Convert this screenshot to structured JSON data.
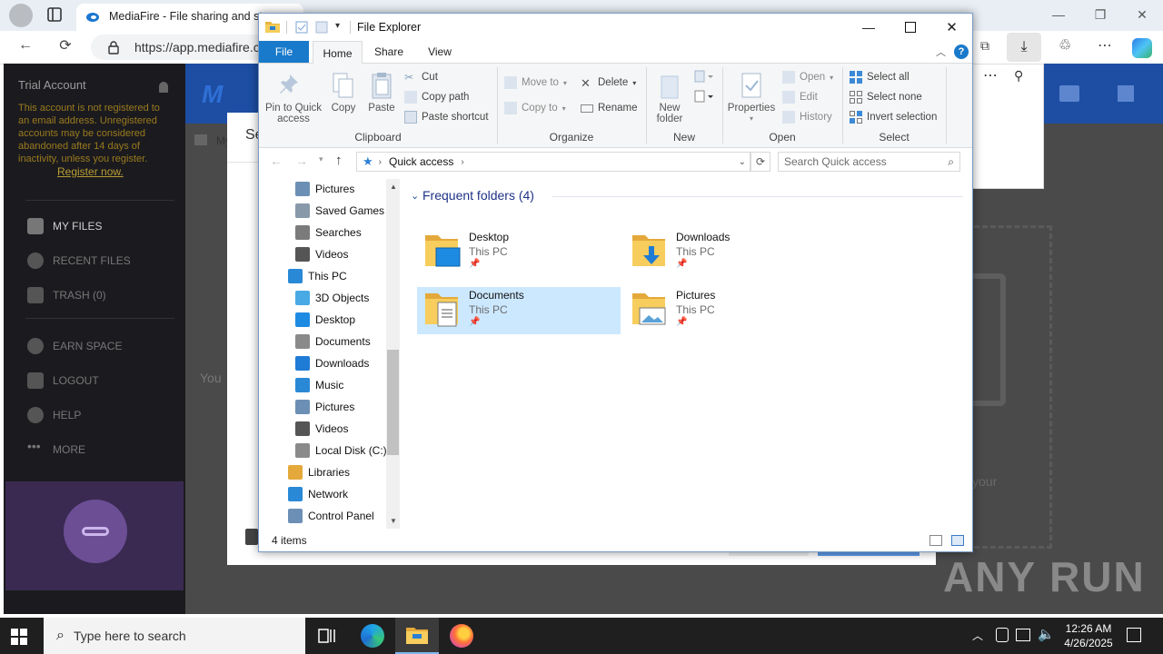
{
  "browser": {
    "tab_title": "MediaFire - File sharing and sto",
    "url": "https://app.mediafire.c"
  },
  "mediafire": {
    "sidebar": {
      "account_title": "Trial Account",
      "account_notice": "This account is not registered to an email address. Unregistered accounts may be considered abandoned after 14 days of inactivity, unless you register.",
      "register_link": "Register now.",
      "nav": [
        {
          "label": "MY FILES"
        },
        {
          "label": "RECENT FILES"
        },
        {
          "label": "TRASH (0)"
        },
        {
          "label": "EARN SPACE"
        },
        {
          "label": "LOGOUT"
        },
        {
          "label": "HELP"
        },
        {
          "label": "MORE"
        }
      ]
    },
    "header_logo": "M",
    "breadcrumb_fragment": "My",
    "modal_heading_fragment": "Se",
    "modal_body_fragment": "You",
    "background_text_fragment": "your"
  },
  "explorer": {
    "title": "File Explorer",
    "tabs": [
      "File",
      "Home",
      "Share",
      "View"
    ],
    "ribbon": {
      "clipboard": {
        "label": "Clipboard",
        "pin": "Pin to Quick access",
        "copy": "Copy",
        "paste": "Paste",
        "cut": "Cut",
        "copy_path": "Copy path",
        "paste_shortcut": "Paste shortcut"
      },
      "organize": {
        "label": "Organize",
        "move_to": "Move to",
        "copy_to": "Copy to",
        "delete": "Delete",
        "rename": "Rename"
      },
      "new": {
        "label": "New",
        "new_folder": "New folder"
      },
      "open": {
        "label": "Open",
        "properties": "Properties",
        "open": "Open",
        "edit": "Edit",
        "history": "History"
      },
      "select": {
        "label": "Select",
        "select_all": "Select all",
        "select_none": "Select none",
        "invert": "Invert selection"
      }
    },
    "address": "Quick access",
    "search_placeholder": "Search Quick access",
    "nav_pane": [
      {
        "label": "Pictures"
      },
      {
        "label": "Saved Games"
      },
      {
        "label": "Searches"
      },
      {
        "label": "Videos"
      },
      {
        "label": "This PC"
      },
      {
        "label": "3D Objects"
      },
      {
        "label": "Desktop"
      },
      {
        "label": "Documents"
      },
      {
        "label": "Downloads"
      },
      {
        "label": "Music"
      },
      {
        "label": "Pictures"
      },
      {
        "label": "Videos"
      },
      {
        "label": "Local Disk (C:)"
      },
      {
        "label": "Libraries"
      },
      {
        "label": "Network"
      },
      {
        "label": "Control Panel"
      }
    ],
    "section_header": "Frequent folders (4)",
    "folders": [
      {
        "name": "Desktop",
        "location": "This PC"
      },
      {
        "name": "Downloads",
        "location": "This PC"
      },
      {
        "name": "Documents",
        "location": "This PC"
      },
      {
        "name": "Pictures",
        "location": "This PC"
      }
    ],
    "status": "4 items"
  },
  "taskbar": {
    "search_placeholder": "Type here to search",
    "time": "12:26 AM",
    "date": "4/26/2025"
  },
  "watermark": "ANY RUN",
  "colors": {
    "ribbon_file_tab": "#1979ca",
    "mediafire_header": "#1d4ea3",
    "selection": "#cce8ff"
  }
}
